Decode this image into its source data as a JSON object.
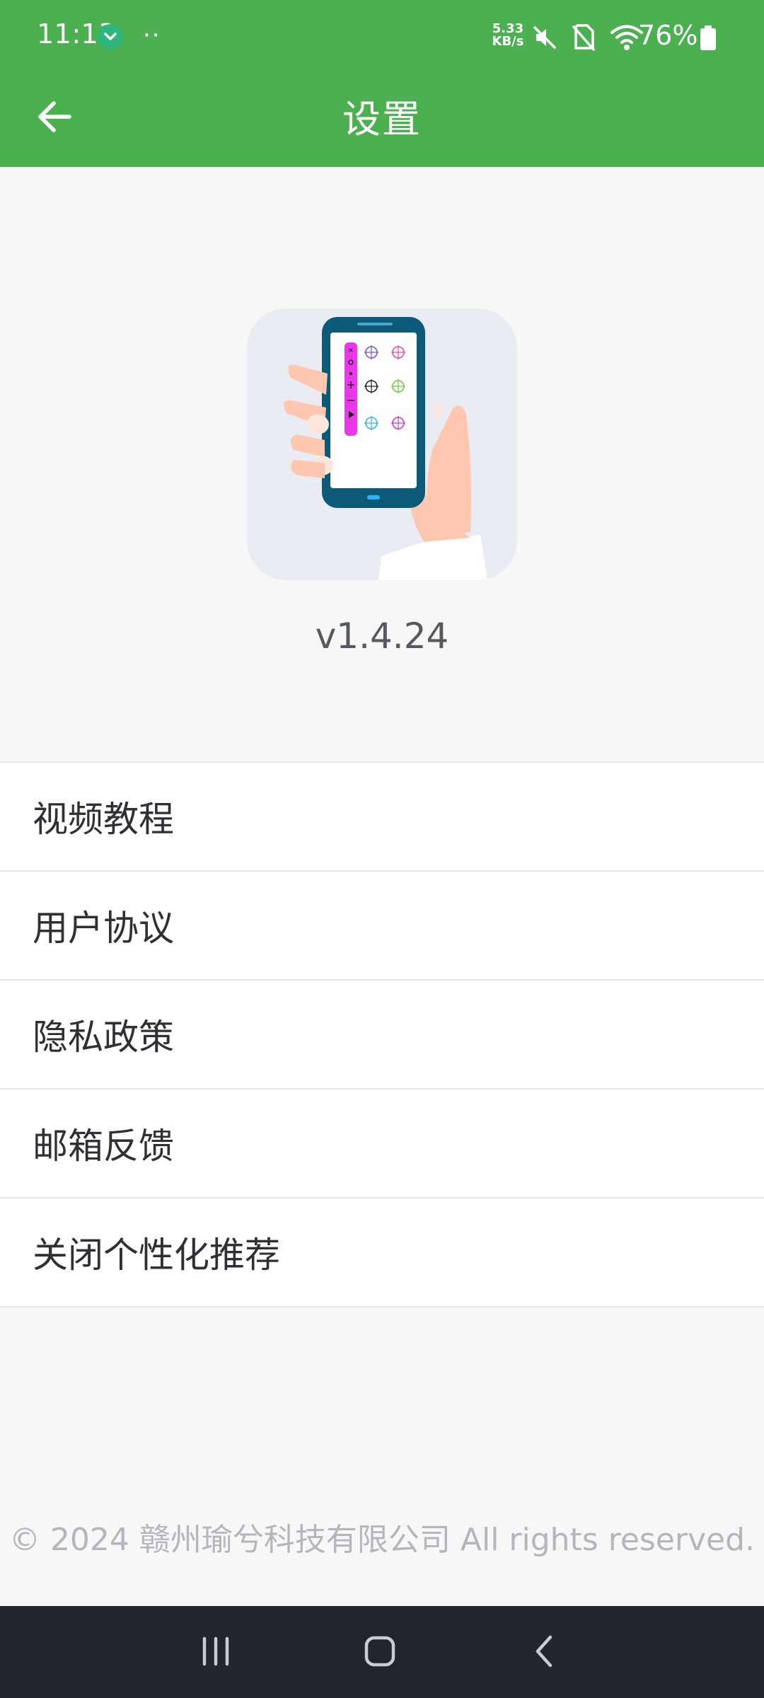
{
  "status_bar": {
    "time": "11:13",
    "more_indicator": "··",
    "net_speed_value": "5.33",
    "net_speed_unit": "KB/s",
    "battery_percent": "76%",
    "icons": [
      "app-notification-icon",
      "mute-icon",
      "no-sim-icon",
      "wifi-icon",
      "battery-icon"
    ]
  },
  "app_bar": {
    "title": "设置",
    "back_icon": "arrow-left-icon"
  },
  "app_info": {
    "logo_icon": "hand-holding-phone-logo",
    "version": "v1.4.24"
  },
  "settings_list": {
    "items": [
      {
        "label": "视频教程"
      },
      {
        "label": "用户协议"
      },
      {
        "label": "隐私政策"
      },
      {
        "label": "邮箱反馈"
      },
      {
        "label": "关闭个性化推荐"
      }
    ]
  },
  "footer": {
    "copyright": "© 2024 赣州瑜兮科技有限公司 All rights reserved."
  },
  "nav_bar": {
    "icons": [
      "recent-apps-icon",
      "home-icon",
      "back-icon"
    ]
  },
  "colors": {
    "primary": "#4caf50",
    "background": "#f7f7f7",
    "list_background": "#ffffff",
    "nav_bar": "#21252e",
    "accent_magenta": "#e838e8",
    "phone_frame": "#0d5a78"
  }
}
